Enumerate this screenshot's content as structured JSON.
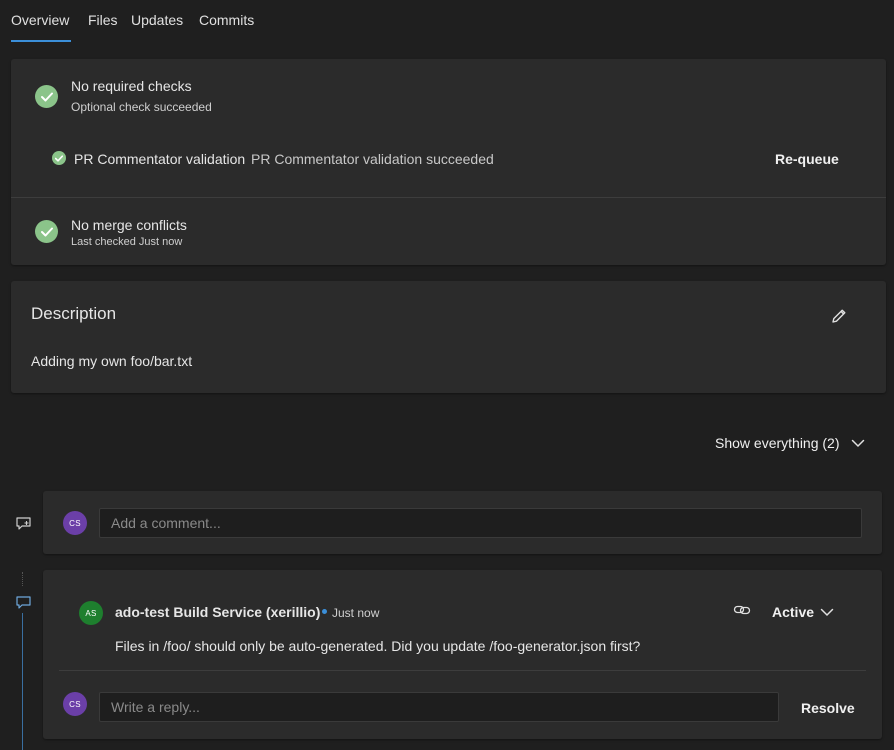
{
  "tabs": [
    {
      "label": "Overview",
      "active": true
    },
    {
      "label": "Files"
    },
    {
      "label": "Updates"
    },
    {
      "label": "Commits"
    }
  ],
  "checks": {
    "required": {
      "title": "No required checks",
      "subtitle": "Optional check succeeded"
    },
    "validation": {
      "name": "PR Commentator validation",
      "status": "PR Commentator validation succeeded",
      "action_label": "Re-queue"
    },
    "merge": {
      "title": "No merge conflicts",
      "subtitle": "Last checked Just now"
    }
  },
  "description": {
    "heading": "Description",
    "body": "Adding my own foo/bar.txt"
  },
  "filter": {
    "label": "Show everything (2)"
  },
  "comment_box": {
    "avatar_initials": "CS",
    "placeholder": "Add a comment..."
  },
  "thread": {
    "author_initials": "AS",
    "author": "ado-test Build Service (xerillio)",
    "timestamp": "Just now",
    "status_label": "Active",
    "message": "Files in /foo/ should only be auto-generated. Did you update /foo-generator.json first?",
    "reply_avatar_initials": "CS",
    "reply_placeholder": "Write a reply...",
    "resolve_label": "Resolve"
  },
  "colors": {
    "accent": "#3b8fd9",
    "success": "#8bc48a",
    "avatar_cs": "#6b3fa8",
    "avatar_as": "#1e7f2e",
    "background": "#1f1f1f",
    "card": "#2b2b2b"
  },
  "icons": {
    "check": "check-circle-icon",
    "edit": "pencil-icon",
    "chevron": "chevron-down-icon",
    "comment_add": "comment-add-icon",
    "comment": "comment-icon",
    "link": "link-icon"
  }
}
